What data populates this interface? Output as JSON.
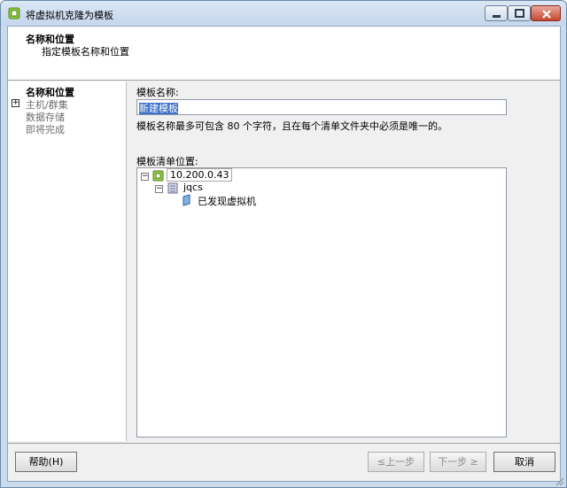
{
  "window": {
    "title": "将虚拟机克隆为模板"
  },
  "header": {
    "title": "名称和位置",
    "subtitle": "指定模板名称和位置"
  },
  "steps": [
    {
      "label": "名称和位置",
      "active": true
    },
    {
      "label": "主机/群集",
      "active": false,
      "expander": "+"
    },
    {
      "label": "数据存储",
      "active": false
    },
    {
      "label": "即将完成",
      "active": false
    }
  ],
  "form": {
    "name_label": "模板名称:",
    "name_value": "新建模板",
    "hint": "模板名称最多可包含 80 个字符，且在每个清单文件夹中必须是唯一的。",
    "location_label": "模板清单位置:"
  },
  "tree": {
    "host": "10.200.0.43",
    "datacenter": "jqcs",
    "folder": "已发现虚拟机",
    "collapse_symbol": "−"
  },
  "buttons": {
    "help": "帮助(H)",
    "back": "≤上一步",
    "next": "下一步 ≥",
    "cancel": "取消"
  }
}
